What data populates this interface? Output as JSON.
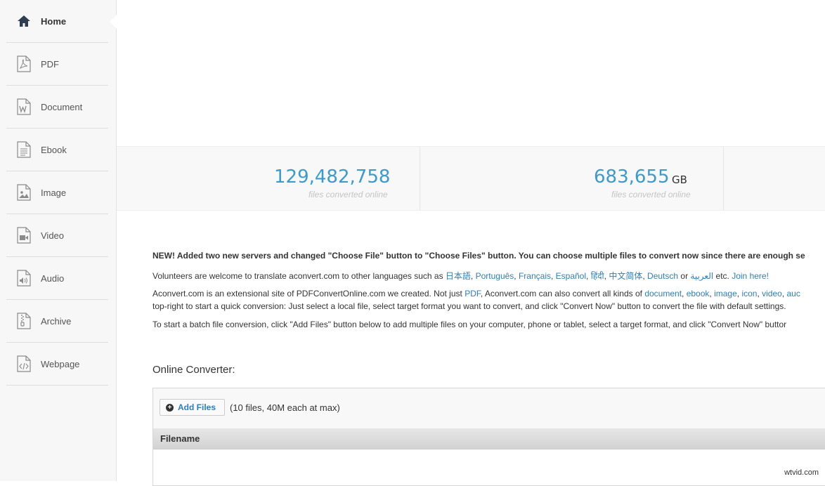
{
  "sidebar": {
    "items": [
      {
        "label": "Home",
        "icon": "home-icon",
        "active": true
      },
      {
        "label": "PDF",
        "icon": "pdf-file-icon"
      },
      {
        "label": "Document",
        "icon": "word-file-icon"
      },
      {
        "label": "Ebook",
        "icon": "ebook-file-icon"
      },
      {
        "label": "Image",
        "icon": "image-file-icon"
      },
      {
        "label": "Video",
        "icon": "video-file-icon"
      },
      {
        "label": "Audio",
        "icon": "audio-file-icon"
      },
      {
        "label": "Archive",
        "icon": "archive-file-icon"
      },
      {
        "label": "Webpage",
        "icon": "webpage-file-icon"
      }
    ]
  },
  "stats": [
    {
      "value": "129,482,758",
      "unit": "",
      "caption": "files converted online"
    },
    {
      "value": "683,655",
      "unit": "GB",
      "caption": "files converted online"
    }
  ],
  "notice": {
    "line1": "NEW! Added two new servers and changed \"Choose File\" button to \"Choose Files\" button. You can choose multiple files to convert now since there are enough se",
    "line2_prefix": "Volunteers are welcome to translate aconvert.com to other languages such as ",
    "languages": [
      "日本語",
      "Português",
      "Français",
      "Español",
      "हिंदी",
      "中文简体",
      "Deutsch"
    ],
    "line2_or": " or ",
    "arabic": "العربية",
    "line2_etc": " etc. ",
    "join": "Join here!",
    "line3_prefix": "Aconvert.com is an extensional site of PDFConvertOnline.com we created. Not just ",
    "line3_pdf": "PDF",
    "line3_mid": ", Aconvert.com can also convert all kinds of ",
    "line3_links": [
      "document",
      "ebook",
      "image",
      "icon",
      "video",
      "auc"
    ],
    "line4": "top-right to start a quick conversion: Just select a local file, select target format you want to convert, and click \"Convert Now\" button to convert the file with default settings.",
    "line5": "To start a batch file conversion, click \"Add Files\" button below to add multiple files on your computer, phone or tablet, select a target format, and click \"Convert Now\" buttor"
  },
  "converter": {
    "title": "Online Converter:",
    "add_files_label": "Add Files",
    "limit_note": "(10 files, 40M each at max)",
    "column_filename": "Filename"
  },
  "watermark": "wtvid.com",
  "colors": {
    "accent": "#3a9bd1",
    "link": "#2b7fc1"
  }
}
